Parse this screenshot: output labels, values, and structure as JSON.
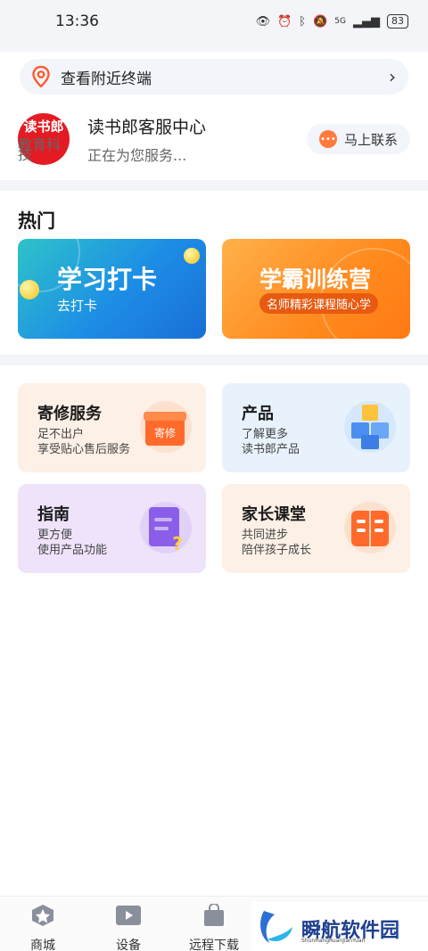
{
  "status_bar": {
    "time": "13:36",
    "network": "5G",
    "battery": "83"
  },
  "nearby": {
    "label": "查看附近终端"
  },
  "service": {
    "logo_text": "读书郎",
    "logo_subtext": "教育科技",
    "title": "读书郎客服中心",
    "subtitle": "正在为您服务...",
    "contact_label": "马上联系"
  },
  "hot": {
    "title": "热门",
    "banners": [
      {
        "title": "学习打卡",
        "subtitle": "去打卡"
      },
      {
        "title": "学霸训练营",
        "subtitle": "名师精彩课程随心学"
      }
    ]
  },
  "cards": [
    {
      "title": "寄修服务",
      "line1": "足不出户",
      "line2": "享受贴心售后服务",
      "icon_label": "寄修"
    },
    {
      "title": "产品",
      "line1": "了解更多",
      "line2": "读书郎产品"
    },
    {
      "title": "指南",
      "line1": "更方便",
      "line2": "使用产品功能"
    },
    {
      "title": "家长课堂",
      "line1": "共同进步",
      "line2": "陪伴孩子成长"
    }
  ],
  "tabs": [
    {
      "label": "商城",
      "icon": "star-icon"
    },
    {
      "label": "设备",
      "icon": "play-icon"
    },
    {
      "label": "远程下载",
      "icon": "bag-icon"
    }
  ],
  "watermark": {
    "text": "瞬航软件园",
    "subtext": "ShunHangRuanJianYuan"
  },
  "colors": {
    "brand_red": "#e41b23",
    "accent_orange": "#ff8a1e",
    "accent_blue": "#1d8de6"
  }
}
